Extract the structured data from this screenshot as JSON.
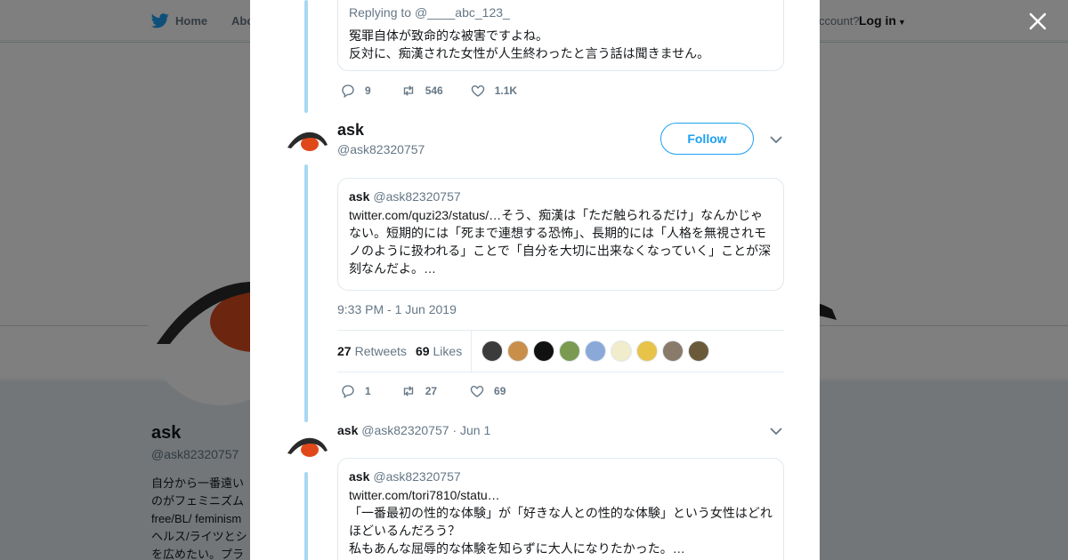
{
  "nav": {
    "home": "Home",
    "about": "Abo",
    "account_prompt": "ccount?",
    "login": "Log in"
  },
  "background_profile": {
    "name": "ask",
    "handle": "@ask82320757",
    "bio_lines": [
      "自分から一番遠い",
      "のがフェミニズム",
      "free/BL/ feminism",
      "ヘルス/ライツとシ",
      "を広めたい。プラ"
    ]
  },
  "modal": {
    "reply_tweet": {
      "replying_to_prefix": "Replying to ",
      "replying_to_handle": "@____abc_123_",
      "lines": [
        "冤罪自体が致命的な被害ですよね。",
        "反対に、痴漢された女性が人生終わったと言う話は聞きません。"
      ],
      "actions": {
        "replies": "9",
        "retweets": "546",
        "likes": "1.1K"
      }
    },
    "main_tweet": {
      "name": "ask",
      "handle": "@ask82320757",
      "follow_label": "Follow",
      "quote": {
        "name": "ask",
        "handle": "@ask82320757",
        "text": "twitter.com/quzi23/status/…そう、痴漢は「ただ触られるだけ」なんかじゃない。短期的には「死まで連想する恐怖」、長期的には「人格を無視されモノのように扱われる」ことで「自分を大切に出来なくなっていく」ことが深刻なんだよ。…"
      },
      "timestamp": "9:33 PM - 1 Jun 2019",
      "retweets_count": "27",
      "retweets_label": "Retweets",
      "likes_count": "69",
      "likes_label": "Likes",
      "liker_colors": [
        "#3b3b3b",
        "#c98f4a",
        "#111111",
        "#7a9a52",
        "#8aa8d8",
        "#f0eccc",
        "#e8c34a",
        "#8a7a6a",
        "#6b5a3a"
      ],
      "actions": {
        "replies": "1",
        "retweets": "27",
        "likes": "69"
      }
    },
    "next_tweet": {
      "name": "ask",
      "handle": "@ask82320757",
      "date": "· Jun 1",
      "quote": {
        "name": "ask",
        "handle": "@ask82320757",
        "lines": [
          "twitter.com/tori7810/statu…",
          "「一番最初の性的な体験」が「好きな人との性的な体験」という女性はどれほどいるんだろう？",
          "私もあんな屈辱的な体験を知らずに大人になりたかった。…"
        ]
      }
    }
  },
  "colors": {
    "accent": "#1da1f2",
    "thread_line": "#a8d8f2",
    "muted": "#657786"
  }
}
